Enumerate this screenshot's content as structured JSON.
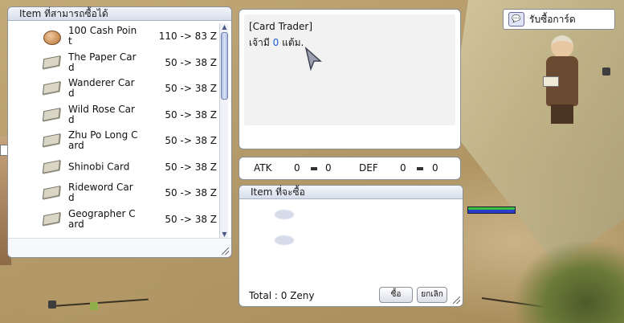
{
  "npc_bubble": {
    "label": "รับซื้อการ์ด",
    "icon": "chat-icon"
  },
  "shop": {
    "title": "Item ที่สามารถซื้อได้",
    "items": [
      {
        "name": "100 Cash Point",
        "price": "110 -> 83 Z",
        "icon": "coin-icon"
      },
      {
        "name": "The Paper Card",
        "price": "50 -> 38 Z",
        "icon": "card-icon"
      },
      {
        "name": "Wanderer Card",
        "price": "50 -> 38 Z",
        "icon": "card-icon"
      },
      {
        "name": "Wild Rose Card",
        "price": "50 -> 38 Z",
        "icon": "card-icon"
      },
      {
        "name": "Zhu Po Long Card",
        "price": "50 -> 38 Z",
        "icon": "card-icon"
      },
      {
        "name": "Shinobi Card",
        "price": "50 -> 38 Z",
        "icon": "card-icon"
      },
      {
        "name": "Rideword Card",
        "price": "50 -> 38 Z",
        "icon": "card-icon"
      },
      {
        "name": "Geographer Card",
        "price": "50 -> 38 Z",
        "icon": "card-icon"
      }
    ]
  },
  "dialog": {
    "speaker": "[Card Trader]",
    "line_prefix": "เจ้ามี",
    "points": "0",
    "line_suffix": "แต้ม."
  },
  "stats": {
    "atk_label": "ATK",
    "atk_value": "0",
    "atk_bonus": "0",
    "def_label": "DEF",
    "def_value": "0",
    "def_bonus": "0"
  },
  "buy": {
    "title": "Item ที่จะซื้อ",
    "total": "Total : 0 Zeny",
    "buy_label": "ซื้อ",
    "cancel_label": "ยกเลิก"
  },
  "colors": {
    "accent": "#1e5bd6",
    "hp_bar": "#2a3cc8",
    "sp_bar": "#36c23a"
  }
}
